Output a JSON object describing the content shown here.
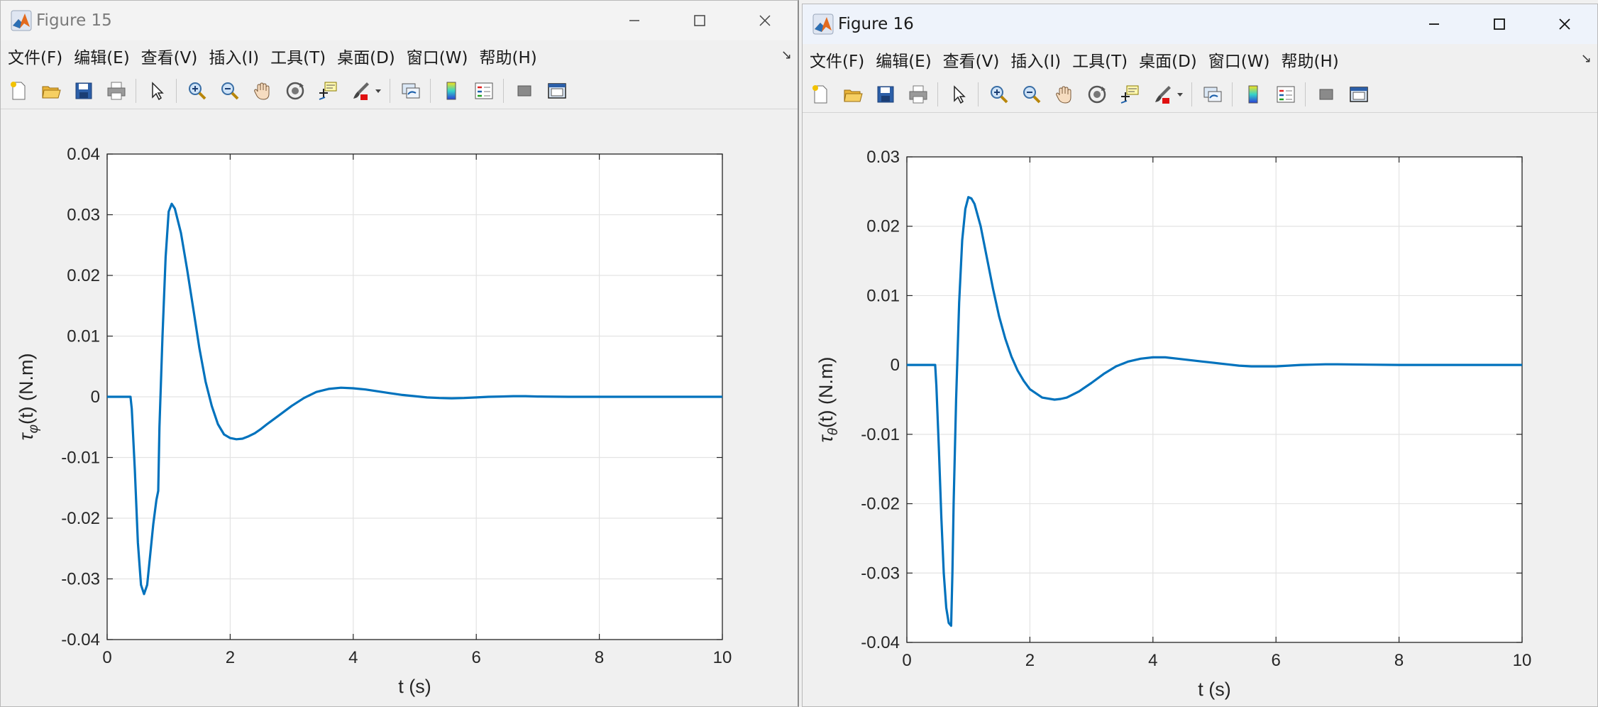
{
  "windows": [
    {
      "title": "Figure 15",
      "menu": [
        "文件(F)",
        "编辑(E)",
        "查看(V)",
        "插入(I)",
        "工具(T)",
        "桌面(D)",
        "窗口(W)",
        "帮助(H)"
      ],
      "chart_data": {
        "type": "line",
        "title": "",
        "xlabel": "t (s)",
        "ylabel": "τφ(t) (N.m)",
        "xlim": [
          0,
          10
        ],
        "ylim": [
          -0.04,
          0.04
        ],
        "xticks": [
          "0",
          "2",
          "4",
          "6",
          "8",
          "10"
        ],
        "yticks": [
          "0.04",
          "0.03",
          "0.02",
          "0.01",
          "0",
          "-0.01",
          "-0.02",
          "-0.03",
          "-0.04"
        ],
        "grid": true,
        "color": "#0072BD",
        "series": [
          {
            "x": [
              0,
              0.38,
              0.4,
              0.45,
              0.5,
              0.55,
              0.6,
              0.65,
              0.7,
              0.75,
              0.8,
              0.83,
              0.85,
              0.9,
              0.95,
              1.0,
              1.05,
              1.1,
              1.2,
              1.3,
              1.4,
              1.5,
              1.6,
              1.7,
              1.8,
              1.9,
              2.0,
              2.1,
              2.2,
              2.3,
              2.4,
              2.5,
              2.6,
              2.8,
              3.0,
              3.2,
              3.4,
              3.6,
              3.8,
              4.0,
              4.2,
              4.4,
              4.6,
              4.8,
              5.0,
              5.2,
              5.4,
              5.6,
              5.8,
              6.0,
              6.2,
              6.4,
              6.6,
              6.8,
              7.0,
              7.5,
              8.0,
              8.5,
              9.0,
              9.5,
              10.0
            ],
            "y": [
              0,
              0,
              -0.002,
              -0.012,
              -0.024,
              -0.031,
              -0.0325,
              -0.031,
              -0.026,
              -0.021,
              -0.017,
              -0.0155,
              -0.005,
              0.01,
              0.023,
              0.0305,
              0.0318,
              0.031,
              0.027,
              0.021,
              0.0145,
              0.008,
              0.0025,
              -0.0015,
              -0.0045,
              -0.0062,
              -0.0068,
              -0.007,
              -0.0069,
              -0.0065,
              -0.006,
              -0.0053,
              -0.0045,
              -0.003,
              -0.0015,
              -0.0002,
              0.0008,
              0.0013,
              0.0015,
              0.0014,
              0.0012,
              0.0009,
              0.0006,
              0.0003,
              0.0001,
              -0.0001,
              -0.0002,
              -0.00025,
              -0.0002,
              -0.0001,
              0,
              5e-05,
              0.0001,
              0.0001,
              5e-05,
              0,
              0,
              0,
              0,
              0,
              0
            ]
          }
        ]
      }
    },
    {
      "title": "Figure 16",
      "menu": [
        "文件(F)",
        "编辑(E)",
        "查看(V)",
        "插入(I)",
        "工具(T)",
        "桌面(D)",
        "窗口(W)",
        "帮助(H)"
      ],
      "chart_data": {
        "type": "line",
        "title": "",
        "xlabel": "t (s)",
        "ylabel": "τθ(t) (N.m)",
        "xlim": [
          0,
          10
        ],
        "ylim": [
          -0.04,
          0.03
        ],
        "xticks": [
          "0",
          "2",
          "4",
          "6",
          "8",
          "10"
        ],
        "yticks": [
          "0.03",
          "0.02",
          "0.01",
          "0",
          "-0.01",
          "-0.02",
          "-0.03",
          "-0.04"
        ],
        "grid": true,
        "color": "#0072BD",
        "series": [
          {
            "x": [
              0,
              0.46,
              0.48,
              0.52,
              0.56,
              0.6,
              0.64,
              0.68,
              0.72,
              0.74,
              0.76,
              0.8,
              0.85,
              0.9,
              0.95,
              1.0,
              1.05,
              1.1,
              1.2,
              1.3,
              1.4,
              1.5,
              1.6,
              1.7,
              1.8,
              1.9,
              2.0,
              2.2,
              2.4,
              2.5,
              2.6,
              2.8,
              3.0,
              3.2,
              3.4,
              3.6,
              3.8,
              4.0,
              4.2,
              4.4,
              4.6,
              4.8,
              5.0,
              5.2,
              5.4,
              5.6,
              5.8,
              6.0,
              6.2,
              6.4,
              6.6,
              6.8,
              7.0,
              7.5,
              8.0,
              8.5,
              9.0,
              9.5,
              10.0
            ],
            "y": [
              0,
              0,
              -0.003,
              -0.012,
              -0.022,
              -0.03,
              -0.035,
              -0.0372,
              -0.0376,
              -0.03,
              -0.02,
              -0.005,
              0.009,
              0.018,
              0.0225,
              0.0242,
              0.024,
              0.0232,
              0.02,
              0.0155,
              0.011,
              0.007,
              0.0038,
              0.0012,
              -0.0008,
              -0.0023,
              -0.0035,
              -0.0047,
              -0.005,
              -0.0049,
              -0.0047,
              -0.0038,
              -0.0026,
              -0.0013,
              -0.0002,
              0.0005,
              0.0009,
              0.0011,
              0.0011,
              0.0009,
              0.0007,
              0.0005,
              0.0003,
              0.0001,
              -0.0001,
              -0.0002,
              -0.0002,
              -0.0002,
              -0.0001,
              0,
              5e-05,
              0.0001,
              0.0001,
              5e-05,
              0,
              0,
              0,
              0,
              0
            ]
          }
        ]
      }
    }
  ]
}
